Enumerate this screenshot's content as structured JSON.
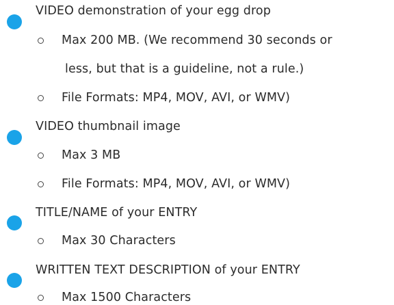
{
  "sections": [
    {
      "heading": "VIDEO demonstration of your egg drop",
      "items": [
        [
          "Max 200 MB. (We recommend 30 seconds or",
          "less, but that is a guideline, not a rule.)"
        ],
        [
          "File Formats: MP4, MOV, AVI, or WMV)"
        ]
      ]
    },
    {
      "heading": "VIDEO thumbnail image",
      "items": [
        [
          "Max 3 MB"
        ],
        [
          "File Formats: MP4, MOV, AVI, or WMV)"
        ]
      ]
    },
    {
      "heading": "TITLE/NAME of your ENTRY",
      "items": [
        [
          "Max 30 Characters"
        ]
      ]
    },
    {
      "heading": "WRITTEN TEXT DESCRIPTION of your ENTRY",
      "items": [
        [
          "Max 1500 Characters"
        ]
      ]
    }
  ]
}
